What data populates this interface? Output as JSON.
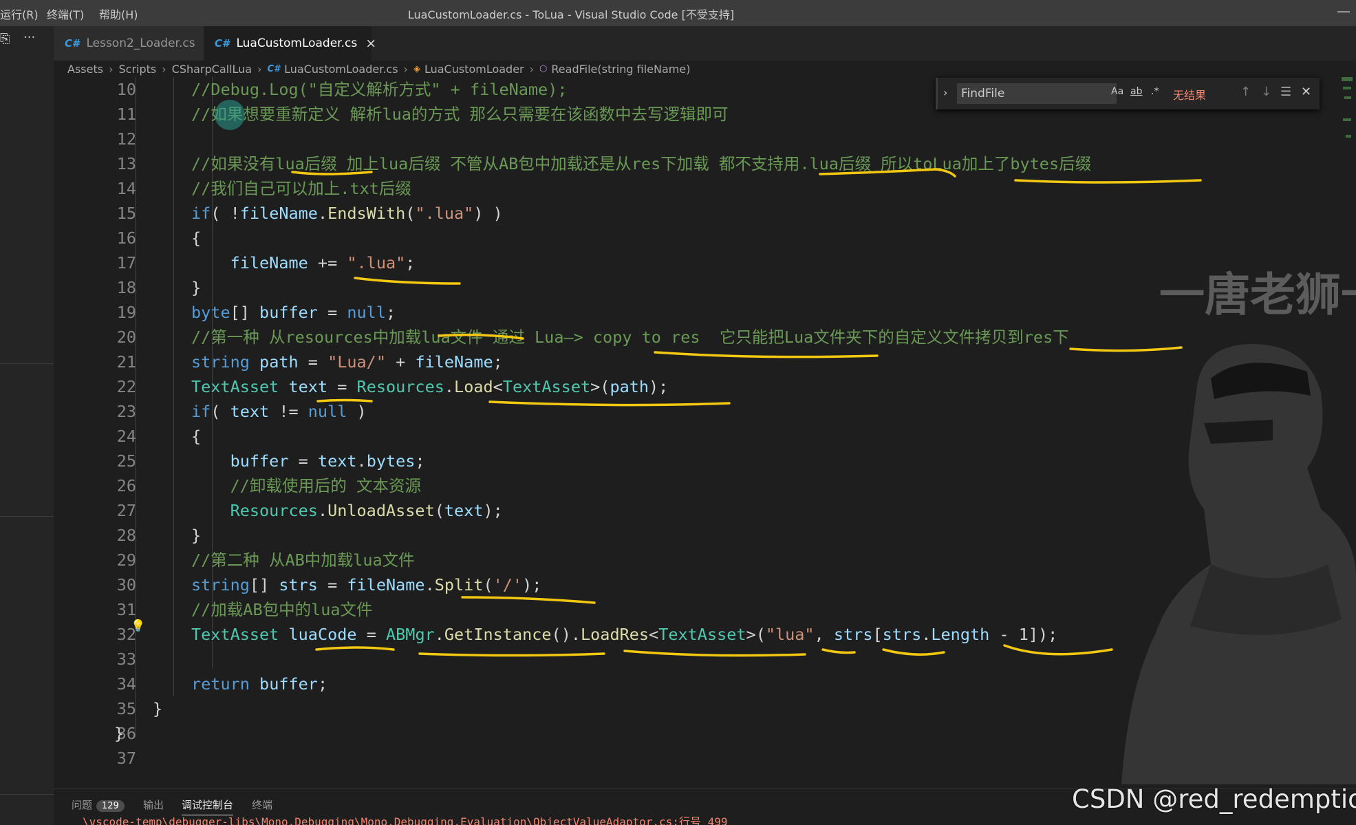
{
  "menu": [
    "运行(R)",
    "终端(T)",
    "帮助(H)"
  ],
  "window_title": "LuaCustomLoader.cs - ToLua - Visual Studio Code [不受支持]",
  "window_controls": "—",
  "sidebar": {
    "explorer_icon": "⎘",
    "more_icon": "···"
  },
  "tabs": [
    {
      "icon": "C#",
      "label": "Lesson2_Loader.cs"
    },
    {
      "icon": "C#",
      "label": "LuaCustomLoader.cs",
      "close": "×"
    }
  ],
  "breadcrumb": [
    "Assets",
    "Scripts",
    "CSharpCallLua",
    "LuaCustomLoader.cs",
    "LuaCustomLoader",
    "ReadFile(string fileName)"
  ],
  "find": {
    "value": "FindFile",
    "opt_case": "Aa",
    "opt_word": "ab",
    "opt_regex": ".*",
    "result": "无结果",
    "prev": "↑",
    "next": "↓",
    "sel": "☰",
    "close": "✕"
  },
  "code_lines": [
    {
      "n": "10",
      "tokens": [
        [
          "c-com",
          "//Debug.Log(\"自定义解析方式\" + fileName);"
        ]
      ]
    },
    {
      "n": "11",
      "tokens": [
        [
          "c-com",
          "//如果想要重新定义 解析lua的方式 那么只需要在该函数中去写逻辑即可"
        ]
      ]
    },
    {
      "n": "12",
      "tokens": []
    },
    {
      "n": "13",
      "tokens": [
        [
          "c-com",
          "//如果没有lua后缀 加上lua后缀 不管从AB包中加载还是从res下加载 都不支持用.lua后缀 所以toLua加上了bytes后缀"
        ]
      ]
    },
    {
      "n": "14",
      "tokens": [
        [
          "c-com",
          "//我们自己可以加上.txt后缀"
        ]
      ]
    },
    {
      "n": "15",
      "tokens": [
        [
          "c-kw",
          "if"
        ],
        [
          "c-pl",
          "( !"
        ],
        [
          "c-var",
          "fileName"
        ],
        [
          "c-pl",
          "."
        ],
        [
          "c-fn",
          "EndsWith"
        ],
        [
          "c-pl",
          "("
        ],
        [
          "c-str",
          "\".lua\""
        ],
        [
          "c-pl",
          ") )"
        ]
      ]
    },
    {
      "n": "16",
      "tokens": [
        [
          "c-pl",
          "{"
        ]
      ]
    },
    {
      "n": "17",
      "tokens": [
        [
          "c-pl",
          "    "
        ],
        [
          "c-var",
          "fileName"
        ],
        [
          "c-pl",
          " += "
        ],
        [
          "c-str",
          "\".lua\""
        ],
        [
          "c-pl",
          ";"
        ]
      ]
    },
    {
      "n": "18",
      "tokens": [
        [
          "c-pl",
          "}"
        ]
      ]
    },
    {
      "n": "19",
      "tokens": [
        [
          "c-kw",
          "byte"
        ],
        [
          "c-pl",
          "[] "
        ],
        [
          "c-var",
          "buffer"
        ],
        [
          "c-pl",
          " = "
        ],
        [
          "c-kw",
          "null"
        ],
        [
          "c-pl",
          ";"
        ]
      ]
    },
    {
      "n": "20",
      "tokens": [
        [
          "c-com",
          "//第一种 从resources中加载lua文件 通过 Lua—> copy to res  它只能把Lua文件夹下的自定义文件拷贝到res下"
        ]
      ]
    },
    {
      "n": "21",
      "tokens": [
        [
          "c-kw",
          "string"
        ],
        [
          "c-pl",
          " "
        ],
        [
          "c-var",
          "path"
        ],
        [
          "c-pl",
          " = "
        ],
        [
          "c-str",
          "\"Lua/\""
        ],
        [
          "c-pl",
          " + "
        ],
        [
          "c-var",
          "fileName"
        ],
        [
          "c-pl",
          ";"
        ]
      ]
    },
    {
      "n": "22",
      "tokens": [
        [
          "c-type",
          "TextAsset"
        ],
        [
          "c-pl",
          " "
        ],
        [
          "c-var",
          "text"
        ],
        [
          "c-pl",
          " = "
        ],
        [
          "c-type",
          "Resources"
        ],
        [
          "c-pl",
          "."
        ],
        [
          "c-fn",
          "Load"
        ],
        [
          "c-pl",
          "<"
        ],
        [
          "c-type",
          "TextAsset"
        ],
        [
          "c-pl",
          ">("
        ],
        [
          "c-var",
          "path"
        ],
        [
          "c-pl",
          ");"
        ]
      ]
    },
    {
      "n": "23",
      "tokens": [
        [
          "c-kw",
          "if"
        ],
        [
          "c-pl",
          "( "
        ],
        [
          "c-var",
          "text"
        ],
        [
          "c-pl",
          " != "
        ],
        [
          "c-kw",
          "null"
        ],
        [
          "c-pl",
          " )"
        ]
      ]
    },
    {
      "n": "24",
      "tokens": [
        [
          "c-pl",
          "{"
        ]
      ]
    },
    {
      "n": "25",
      "tokens": [
        [
          "c-pl",
          "    "
        ],
        [
          "c-var",
          "buffer"
        ],
        [
          "c-pl",
          " = "
        ],
        [
          "c-var",
          "text"
        ],
        [
          "c-pl",
          "."
        ],
        [
          "c-var",
          "bytes"
        ],
        [
          "c-pl",
          ";"
        ]
      ]
    },
    {
      "n": "26",
      "tokens": [
        [
          "c-pl",
          "    "
        ],
        [
          "c-com",
          "//卸载使用后的 文本资源"
        ]
      ]
    },
    {
      "n": "27",
      "tokens": [
        [
          "c-pl",
          "    "
        ],
        [
          "c-type",
          "Resources"
        ],
        [
          "c-pl",
          "."
        ],
        [
          "c-fn",
          "UnloadAsset"
        ],
        [
          "c-pl",
          "("
        ],
        [
          "c-var",
          "text"
        ],
        [
          "c-pl",
          ");"
        ]
      ]
    },
    {
      "n": "28",
      "tokens": [
        [
          "c-pl",
          "}"
        ]
      ]
    },
    {
      "n": "29",
      "tokens": [
        [
          "c-com",
          "//第二种 从AB中加载lua文件"
        ]
      ]
    },
    {
      "n": "30",
      "tokens": [
        [
          "c-kw",
          "string"
        ],
        [
          "c-pl",
          "[] "
        ],
        [
          "c-var",
          "strs"
        ],
        [
          "c-pl",
          " = "
        ],
        [
          "c-var",
          "fileName"
        ],
        [
          "c-pl",
          "."
        ],
        [
          "c-fn",
          "Split"
        ],
        [
          "c-pl",
          "("
        ],
        [
          "c-str",
          "'/'"
        ],
        [
          "c-pl",
          ");"
        ]
      ]
    },
    {
      "n": "31",
      "tokens": [
        [
          "c-com",
          "//加载AB包中的lua文件"
        ]
      ]
    },
    {
      "n": "32",
      "tokens": [
        [
          "c-type",
          "TextAsset"
        ],
        [
          "c-pl",
          " "
        ],
        [
          "c-var",
          "luaCode"
        ],
        [
          "c-pl",
          " = "
        ],
        [
          "c-type",
          "ABMgr"
        ],
        [
          "c-pl",
          "."
        ],
        [
          "c-fn",
          "GetInstance"
        ],
        [
          "c-pl",
          "()."
        ],
        [
          "c-fn",
          "LoadRes"
        ],
        [
          "c-pl",
          "<"
        ],
        [
          "c-type",
          "TextAsset"
        ],
        [
          "c-pl",
          ">("
        ],
        [
          "c-str",
          "\"lua\""
        ],
        [
          "c-pl",
          ", "
        ],
        [
          "c-var",
          "strs"
        ],
        [
          "c-pl",
          "["
        ],
        [
          "c-var",
          "strs"
        ],
        [
          "c-pl",
          "."
        ],
        [
          "c-var",
          "Length"
        ],
        [
          "c-pl",
          " - 1]);"
        ]
      ]
    },
    {
      "n": "33",
      "tokens": []
    },
    {
      "n": "34",
      "tokens": [
        [
          "c-kw",
          "return"
        ],
        [
          "c-pl",
          " "
        ],
        [
          "c-var",
          "buffer"
        ],
        [
          "c-pl",
          ";"
        ]
      ]
    },
    {
      "n": "35",
      "tokens": [
        [
          "c-pl",
          "}"
        ]
      ]
    },
    {
      "n": "36",
      "tokens": [
        [
          "c-pl",
          "}"
        ]
      ]
    },
    {
      "n": "37",
      "tokens": []
    }
  ],
  "bulb_icon": "💡",
  "watermark": {
    "text": "一唐老狮一"
  },
  "panel": {
    "tabs": [
      "问题",
      "输出",
      "调试控制台",
      "终端"
    ],
    "problems_count": "129",
    "output_line": "\\vscode-temp\\debugger-libs\\Mono.Debugging\\Mono.Debugging.Evaluation\\ObjectValueAdaptor.cs:行号 499"
  },
  "csdn": "CSDN @red_redemption"
}
